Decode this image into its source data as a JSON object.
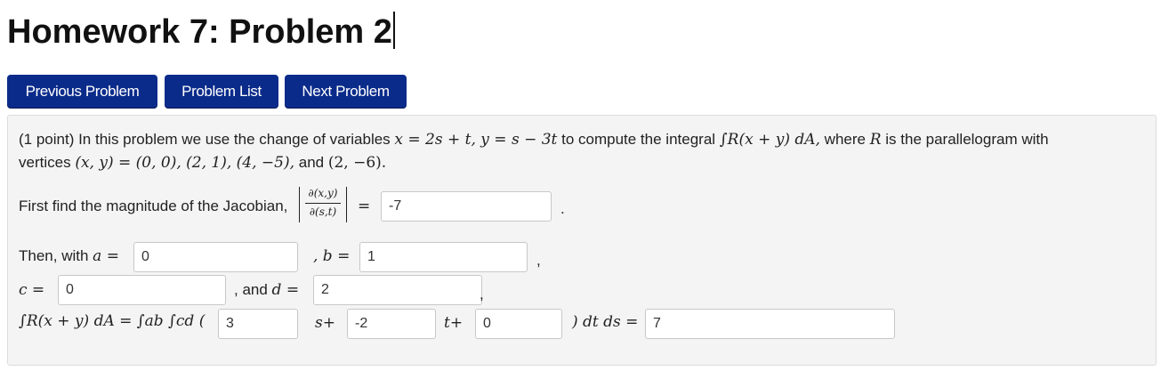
{
  "page": {
    "title": "Homework 7: Problem 2"
  },
  "nav": {
    "previous": "Previous Problem",
    "list": "Problem List",
    "next": "Next Problem"
  },
  "problem": {
    "intro_prefix": "(1 point) In this problem we use the change of variables",
    "substitution": "x = 2s + t, y = s − 3t",
    "intro_mid": "to compute the integral",
    "integral": "∫R(x + y) dA,",
    "intro_where": "where",
    "region": "R",
    "intro_suffix": "is the parallelogram with",
    "vertices_prefix": "vertices",
    "vertices_var": "(x, y) = (0, 0), (2, 1), (4, −5),",
    "vertices_and": "and",
    "vertices_last": "(2, −6).",
    "jacobian_prefix": "First find the magnitude of the Jacobian,",
    "jacobian_num": "∂(x,y)",
    "jacobian_den": "∂(s,t)",
    "equals": "=",
    "jacobian_value": "-7",
    "period": ".",
    "then_with": "Then, with",
    "a_label": "a =",
    "a_value": "0",
    "b_label": ", b =",
    "b_value": "1",
    "comma": ",",
    "c_label": "c =",
    "c_value": "0",
    "d_label": ", and",
    "d_var": "d =",
    "d_value": "2",
    "integral_lhs": "∫R(x + y) dA = ∫ab ∫cd (",
    "coef_s_value": "3",
    "s_plus": "s+",
    "coef_t_value": "-2",
    "t_plus": "t+",
    "const_value": "0",
    "dtds": ") dt ds =",
    "final_value": "7"
  },
  "colors": {
    "button_bg": "#0b2b8a",
    "panel_bg": "#f4f4f4"
  }
}
